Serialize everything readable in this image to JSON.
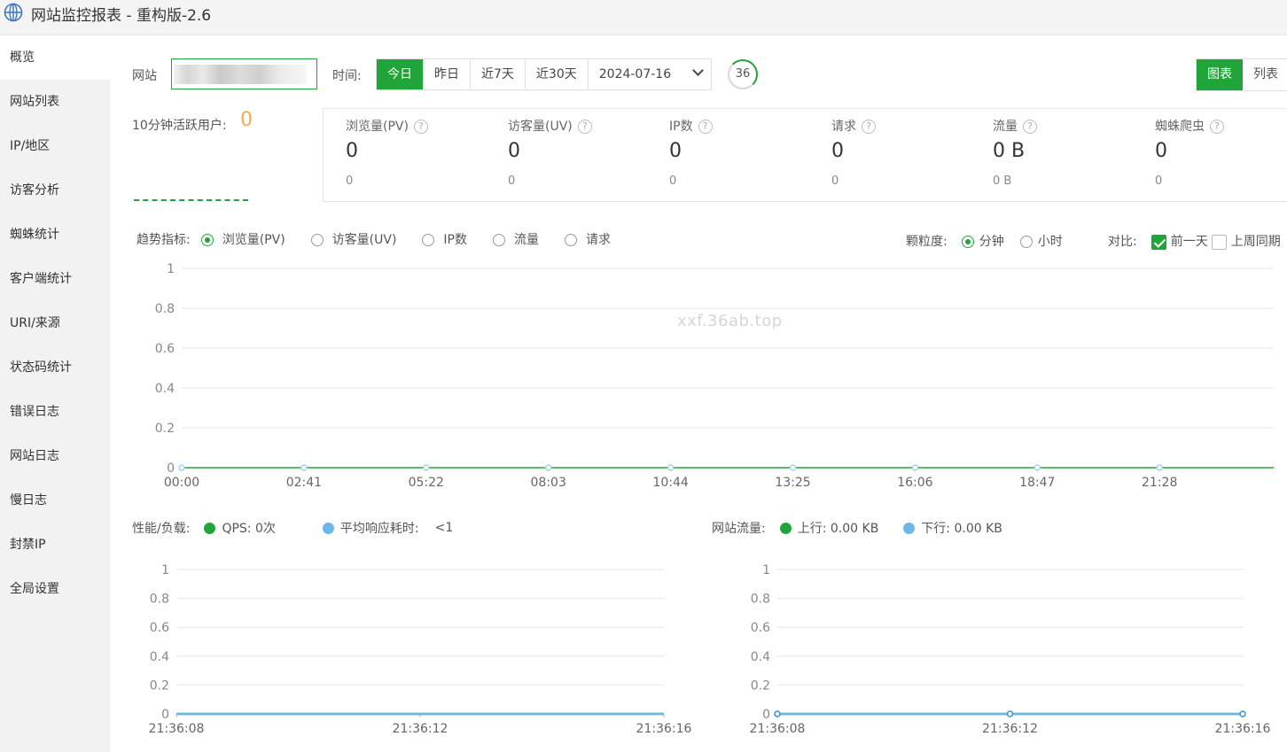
{
  "app": {
    "title": "网站监控报表 - 重构版-2.6",
    "accent": "#20a53a",
    "highlight": "#f0ad4e"
  },
  "sidebar": {
    "items": [
      {
        "label": "概览",
        "active": true
      },
      {
        "label": "网站列表"
      },
      {
        "label": "IP/地区"
      },
      {
        "label": "访客分析"
      },
      {
        "label": "蜘蛛统计"
      },
      {
        "label": "客户端统计"
      },
      {
        "label": "URI/来源"
      },
      {
        "label": "状态码统计"
      },
      {
        "label": "错误日志"
      },
      {
        "label": "网站日志"
      },
      {
        "label": "慢日志"
      },
      {
        "label": "封禁IP"
      },
      {
        "label": "全局设置"
      }
    ]
  },
  "toolbar": {
    "site_label": "网站",
    "time_label": "时间:",
    "time_buttons": [
      "今日",
      "昨日",
      "近7天",
      "近30天"
    ],
    "active_time": "今日",
    "date": "2024-07-16",
    "refresh_count": "36",
    "view_chart": "图表",
    "view_list": "列表"
  },
  "active_users": {
    "label": "10分钟活跃用户:",
    "value": "0"
  },
  "stats": [
    {
      "name": "浏览量(PV)",
      "value": "0",
      "prev": "0"
    },
    {
      "name": "访客量(UV)",
      "value": "0",
      "prev": "0"
    },
    {
      "name": "IP数",
      "value": "0",
      "prev": "0"
    },
    {
      "name": "请求",
      "value": "0",
      "prev": "0"
    },
    {
      "name": "流量",
      "value": "0 B",
      "prev": "0 B"
    },
    {
      "name": "蜘蛛爬虫",
      "value": "0",
      "prev": "0"
    }
  ],
  "trend": {
    "label": "趋势指标:",
    "options": [
      "浏览量(PV)",
      "访客量(UV)",
      "IP数",
      "流量",
      "请求"
    ],
    "selected": "浏览量(PV)",
    "granularity_label": "颗粒度:",
    "granularity": [
      "分钟",
      "小时"
    ],
    "granularity_selected": "分钟",
    "compare_label": "对比:",
    "compare_options": [
      {
        "label": "前一天",
        "checked": true
      },
      {
        "label": "上周同期",
        "checked": false
      }
    ]
  },
  "watermark": "xxf.36ab.top",
  "perf": {
    "label": "性能/负载:",
    "qps": "QPS: 0次",
    "avg_label": "平均响应耗时:",
    "avg_value": "<1"
  },
  "traffic": {
    "label": "网站流量:",
    "up": "上行:  0.00 KB",
    "down": "下行:  0.00 KB"
  },
  "chart_data": [
    {
      "type": "line",
      "title": "",
      "xlabel": "",
      "ylabel": "",
      "ylim": [
        0,
        1
      ],
      "y_ticks": [
        "0",
        "0.2",
        "0.4",
        "0.6",
        "0.8",
        "1"
      ],
      "categories": [
        "00:00",
        "02:41",
        "05:22",
        "08:03",
        "10:44",
        "13:25",
        "16:06",
        "18:47",
        "21:28"
      ],
      "series": [
        {
          "name": "",
          "color": "#20a53a",
          "values": [
            0,
            0,
            0,
            0,
            0,
            0,
            0,
            0,
            0
          ]
        }
      ],
      "grid": true
    },
    {
      "type": "line",
      "title": "",
      "xlabel": "",
      "ylabel": "",
      "ylim": [
        0,
        1
      ],
      "y_ticks": [
        "0",
        "0.2",
        "0.4",
        "0.6",
        "0.8",
        "1"
      ],
      "categories": [
        "21:36:08",
        "21:36:12",
        "21:36:16"
      ],
      "series": [
        {
          "name": "QPS",
          "color": "#20a53a",
          "values": [
            0,
            0,
            0
          ]
        },
        {
          "name": "平均响应耗时",
          "color": "#6fb6e8",
          "values": [
            0,
            0,
            0
          ]
        }
      ],
      "grid": true
    },
    {
      "type": "line",
      "title": "",
      "xlabel": "",
      "ylabel": "",
      "ylim": [
        0,
        1
      ],
      "y_ticks": [
        "0",
        "0.2",
        "0.4",
        "0.6",
        "0.8",
        "1"
      ],
      "categories": [
        "21:36:08",
        "21:36:12",
        "21:36:16"
      ],
      "series": [
        {
          "name": "上行",
          "color": "#20a53a",
          "values": [
            0,
            0,
            0
          ]
        },
        {
          "name": "下行",
          "color": "#6fb6e8",
          "values": [
            0,
            0,
            0
          ]
        }
      ],
      "grid": true
    }
  ]
}
